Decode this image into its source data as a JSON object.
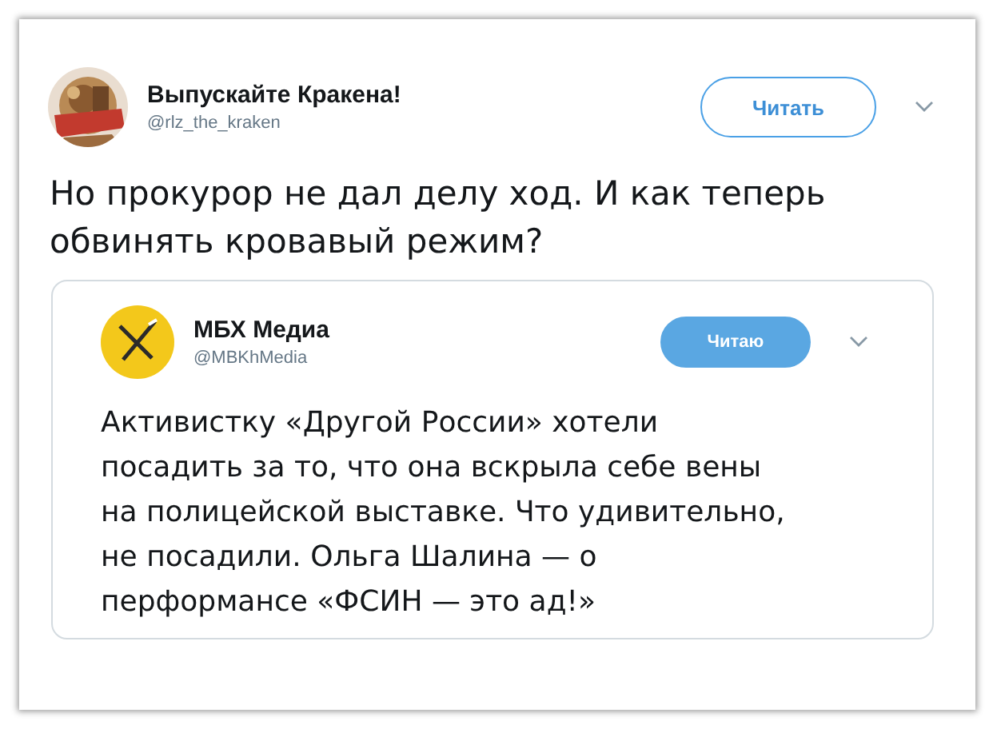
{
  "tweet": {
    "author": {
      "name": "Выпускайте Кракена!",
      "handle": "@rlz_the_kraken"
    },
    "follow_button": {
      "label": "Читать",
      "following": false
    },
    "text": "Но прокурор не дал делу ход. И как теперь обвинять кровавый режим?",
    "quoted_tweet": {
      "author": {
        "name": "МБХ Медиа",
        "handle": "@MBKhMedia"
      },
      "follow_button": {
        "label": "Читаю",
        "following": true
      },
      "text": "Активистку «Другой России» хотели посадить за то, что она вскрыла себе вены на полицейской выставке. Что удивительно, не посадили. Ольга Шалина — о перформансе «ФСИН — это ад!»"
    }
  }
}
